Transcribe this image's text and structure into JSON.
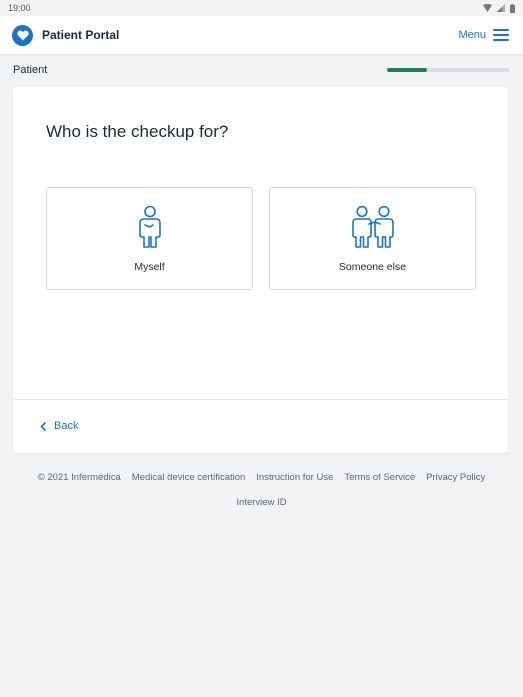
{
  "status_bar": {
    "time": "19:00",
    "icons": [
      "wifi-icon",
      "signal-icon",
      "battery-icon"
    ]
  },
  "header": {
    "title": "Patient Portal",
    "menu_label": "Menu",
    "logo_icon": "heart-icon"
  },
  "subheader": {
    "section": "Patient",
    "progress": 0.33
  },
  "question": {
    "text": "Who is the checkup for?"
  },
  "options": [
    {
      "label": "Myself",
      "icon": "single-person-icon"
    },
    {
      "label": "Someone else",
      "icon": "two-people-icon"
    }
  ],
  "navigation": {
    "back_label": "Back"
  },
  "footer": {
    "copyright": "© 2021 Infermedica",
    "links": [
      "Medical device certification",
      "Instruction for Use",
      "Terms of Service",
      "Privacy Policy"
    ],
    "interview_id": "Interview ID"
  },
  "colors": {
    "accent": "#1a73c9",
    "progress": "#1a7f5a",
    "background": "#f1f3f5"
  }
}
